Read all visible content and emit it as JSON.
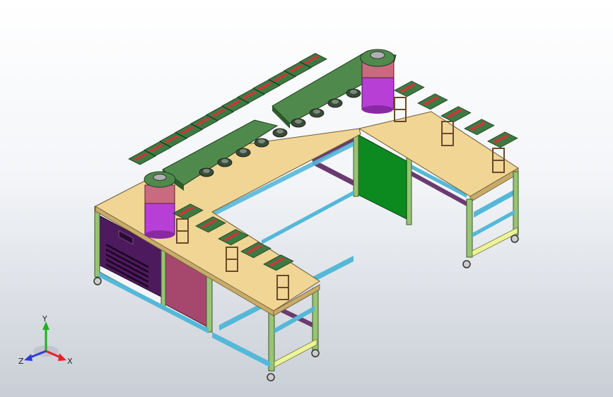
{
  "view": {
    "background_top": "#ffffff",
    "background_bottom": "#c9ced6"
  },
  "model": {
    "colors": {
      "table_top": "#f0d594",
      "frame_upright": "#98c474",
      "frame_edge": "#3d5a2e",
      "rail_blue": "#54b8d8",
      "rail_purple": "#6a3a70",
      "rail_yellow": "#eef29a",
      "cabinet_dark": "#4e1a5e",
      "cabinet_pink": "#a6476e",
      "cabinet_green": "#0c8a1f",
      "conveyor_green": "#4f8a4c",
      "drum_purple": "#b73fd6",
      "drum_pink": "#c96a80",
      "fixture_green": "#3d7a42",
      "fixture_red": "#c23b3b"
    }
  },
  "triad": {
    "x_label": "X",
    "y_label": "Y",
    "z_label": "Z",
    "x_color": "#e22424",
    "y_color": "#20b020",
    "z_color": "#2c3cd8"
  }
}
